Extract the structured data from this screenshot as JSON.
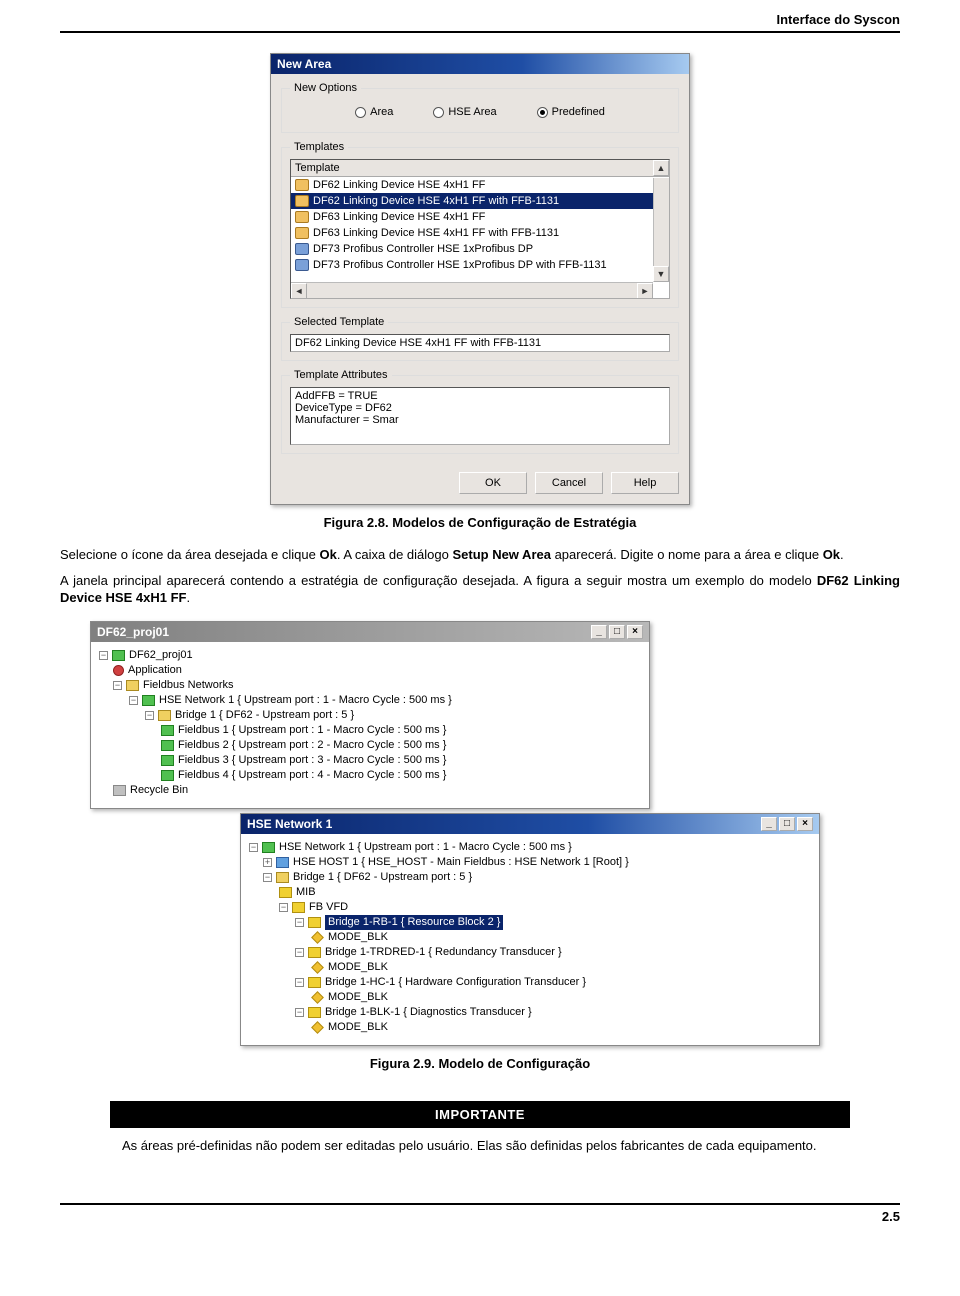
{
  "header": {
    "title": "Interface do Syscon"
  },
  "footer": {
    "page": "2.5"
  },
  "dialog1": {
    "title": "New Area",
    "group_newoptions": "New Options",
    "radios": {
      "area": "Area",
      "hse": "HSE Area",
      "predef": "Predefined"
    },
    "group_templates": "Templates",
    "lv_header": "Template",
    "templates": [
      "DF62 Linking Device HSE 4xH1 FF",
      "DF62 Linking Device HSE 4xH1 FF with FFB-1131",
      "DF63 Linking Device HSE 4xH1 FF",
      "DF63 Linking Device HSE 4xH1 FF with FFB-1131",
      "DF73 Profibus Controller HSE 1xProfibus DP",
      "DF73 Profibus Controller HSE 1xProfibus DP with FFB-1131"
    ],
    "selected_index": 1,
    "group_selected": "Selected Template",
    "selected_value": "DF62 Linking Device HSE 4xH1 FF with FFB-1131",
    "group_attrs": "Template Attributes",
    "attrs": [
      "AddFFB = TRUE",
      "DeviceType = DF62",
      "Manufacturer = Smar"
    ],
    "buttons": {
      "ok": "OK",
      "cancel": "Cancel",
      "help": "Help"
    }
  },
  "caption1": "Figura 2.8. Modelos de Configuração de Estratégia",
  "para1_a": "Selecione o ícone da área desejada e clique ",
  "para1_b": "Ok",
  "para1_c": ". A caixa de diálogo ",
  "para1_d": "Setup New Area",
  "para1_e": " aparecerá. Digite o nome para a área e clique ",
  "para1_f": "Ok",
  "para1_g": ".",
  "para2_a": "A janela principal aparecerá contendo a estratégia de configuração desejada. A figura a seguir mostra um exemplo do modelo ",
  "para2_b": "DF62 Linking Device HSE 4xH1 FF",
  "para2_c": ".",
  "tree1": {
    "title": "DF62_proj01",
    "root": "DF62_proj01",
    "application": "Application",
    "fieldbus_networks": "Fieldbus Networks",
    "hse": "HSE Network 1 { Upstream port : 1 -  Macro Cycle : 500 ms  }",
    "bridge": "Bridge 1 { DF62 -  Upstream port : 5 }",
    "fb1": "Fieldbus 1 { Upstream port : 1 -  Macro Cycle : 500 ms  }",
    "fb2": "Fieldbus 2 { Upstream port : 2 -  Macro Cycle : 500 ms  }",
    "fb3": "Fieldbus 3 { Upstream port : 3 -  Macro Cycle : 500 ms  }",
    "fb4": "Fieldbus 4 { Upstream port : 4 -  Macro Cycle : 500 ms  }",
    "recycle": "Recycle Bin"
  },
  "tree2": {
    "title": "HSE Network 1",
    "hse": "HSE Network 1 { Upstream port : 1 -  Macro Cycle : 500 ms  }",
    "host": "HSE HOST 1 { HSE_HOST -  Main Fieldbus : HSE Network 1 [Root] }",
    "bridge": "Bridge 1 { DF62 -  Upstream port : 5 }",
    "mib": "MIB",
    "fbvfd": "FB VFD",
    "rb": "Bridge 1-RB-1 { Resource Block 2 }",
    "mode": "MODE_BLK",
    "trd": "Bridge 1-TRDRED-1 { Redundancy Transducer }",
    "hc": "Bridge 1-HC-1 { Hardware Configuration Transducer }",
    "blk": "Bridge 1-BLK-1 { Diagnostics Transducer }"
  },
  "caption2": "Figura 2.9. Modelo de Configuração",
  "important": {
    "title": "IMPORTANTE",
    "body": "As áreas pré-definidas não podem ser editadas pelo usuário. Elas são definidas pelos fabricantes de cada equipamento."
  }
}
